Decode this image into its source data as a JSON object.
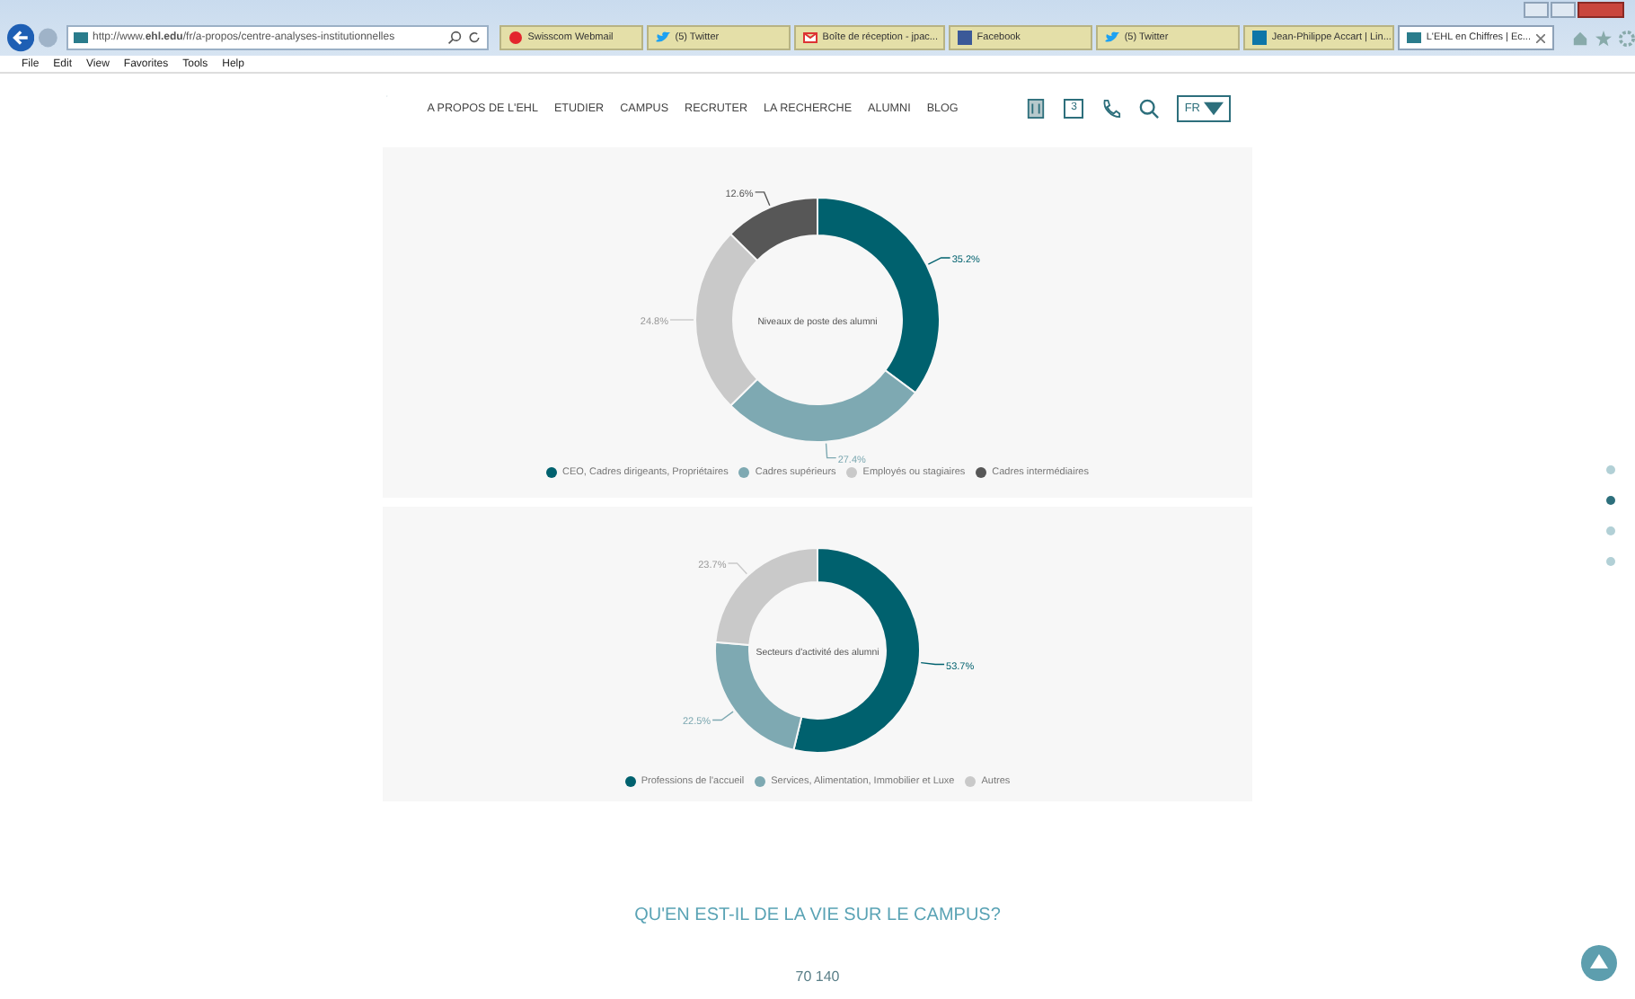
{
  "browser": {
    "address": "http://www.**ehl.edu**/fr/a-propos/centre-analyses-institutionnelles",
    "tabs": [
      {
        "label": "Swisscom Webmail",
        "selected": false
      },
      {
        "label": "(5) Twitter",
        "selected": false
      },
      {
        "label": "Boîte de réception - jpac...",
        "selected": false
      },
      {
        "label": "Facebook",
        "selected": false
      },
      {
        "label": "(5) Twitter",
        "selected": false
      },
      {
        "label": "Jean-Philippe Accart | Lin...",
        "selected": false
      },
      {
        "label": "L'EHL en Chiffres | Ec...",
        "selected": true
      }
    ],
    "menu": [
      "File",
      "Edit",
      "View",
      "Favorites",
      "Tools",
      "Help"
    ]
  },
  "nav": {
    "items": [
      "A PROPOS DE L'EHL",
      "ETUDIER",
      "CAMPUS",
      "RECRUTER",
      "LA RECHERCHE",
      "ALUMNI",
      "BLOG"
    ],
    "calendar_day": "3",
    "language": "FR"
  },
  "charts": [
    {
      "chart_data": {
        "type": "donut",
        "title": "Niveaux de poste des alumni",
        "categories": [
          "CEO, Cadres dirigeants, Propriétaires",
          "Cadres supérieurs",
          "Employés ou stagiaires",
          "Cadres intermédiaires"
        ],
        "values": [
          35.2,
          27.4,
          24.8,
          12.6
        ],
        "value_labels": [
          "35.2%",
          "27.4%",
          "24.8%",
          "12.6%"
        ],
        "legend": true
      },
      "slices": [
        {
          "color": "#00616e"
        },
        {
          "color": "#7ea9b2"
        },
        {
          "color": "#c9c9c9"
        },
        {
          "color": "#575757"
        }
      ]
    },
    {
      "chart_data": {
        "type": "donut",
        "title": "Secteurs d'activité des alumni",
        "categories": [
          "Professions de l'accueil",
          "Services, Alimentation, Immobilier et Luxe",
          "Autres"
        ],
        "values": [
          53.7,
          22.5,
          23.7
        ],
        "value_labels": [
          "53.7%",
          "22.5%",
          "23.7%"
        ],
        "legend": true
      },
      "slices": [
        {
          "color": "#00616e"
        },
        {
          "color": "#7ea9b2"
        },
        {
          "color": "#c9c9c9"
        }
      ]
    }
  ],
  "section_dots": [
    {
      "selected": false
    },
    {
      "selected": true
    },
    {
      "selected": false
    },
    {
      "selected": false
    }
  ],
  "heading": "QU'EN EST-IL DE LA VIE SUR LE CAMPUS?",
  "stat": "70 140"
}
